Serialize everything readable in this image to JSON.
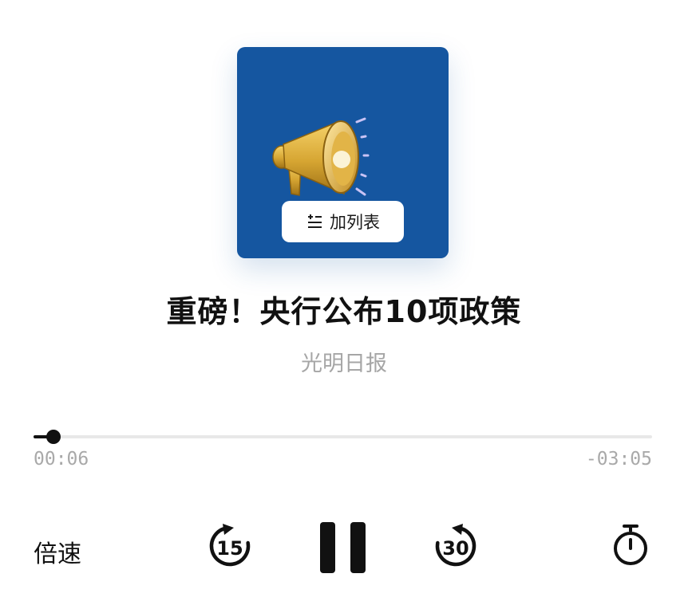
{
  "cover": {
    "image_icon": "megaphone-icon",
    "background_color": "#1556a0",
    "add_list": {
      "icon": "playlist-add-icon",
      "label": "加列表"
    }
  },
  "track": {
    "title": "重磅！央行公布10项政策",
    "source": "光明日报"
  },
  "progress": {
    "elapsed": "00:06",
    "remaining": "-03:05",
    "fraction": 0.032
  },
  "controls": {
    "speed_label": "倍速",
    "rewind": {
      "icon": "rewind-15-icon",
      "seconds": "15"
    },
    "play_state": "pause-icon",
    "forward": {
      "icon": "forward-30-icon",
      "seconds": "30"
    },
    "timer_icon": "sleep-timer-icon"
  }
}
